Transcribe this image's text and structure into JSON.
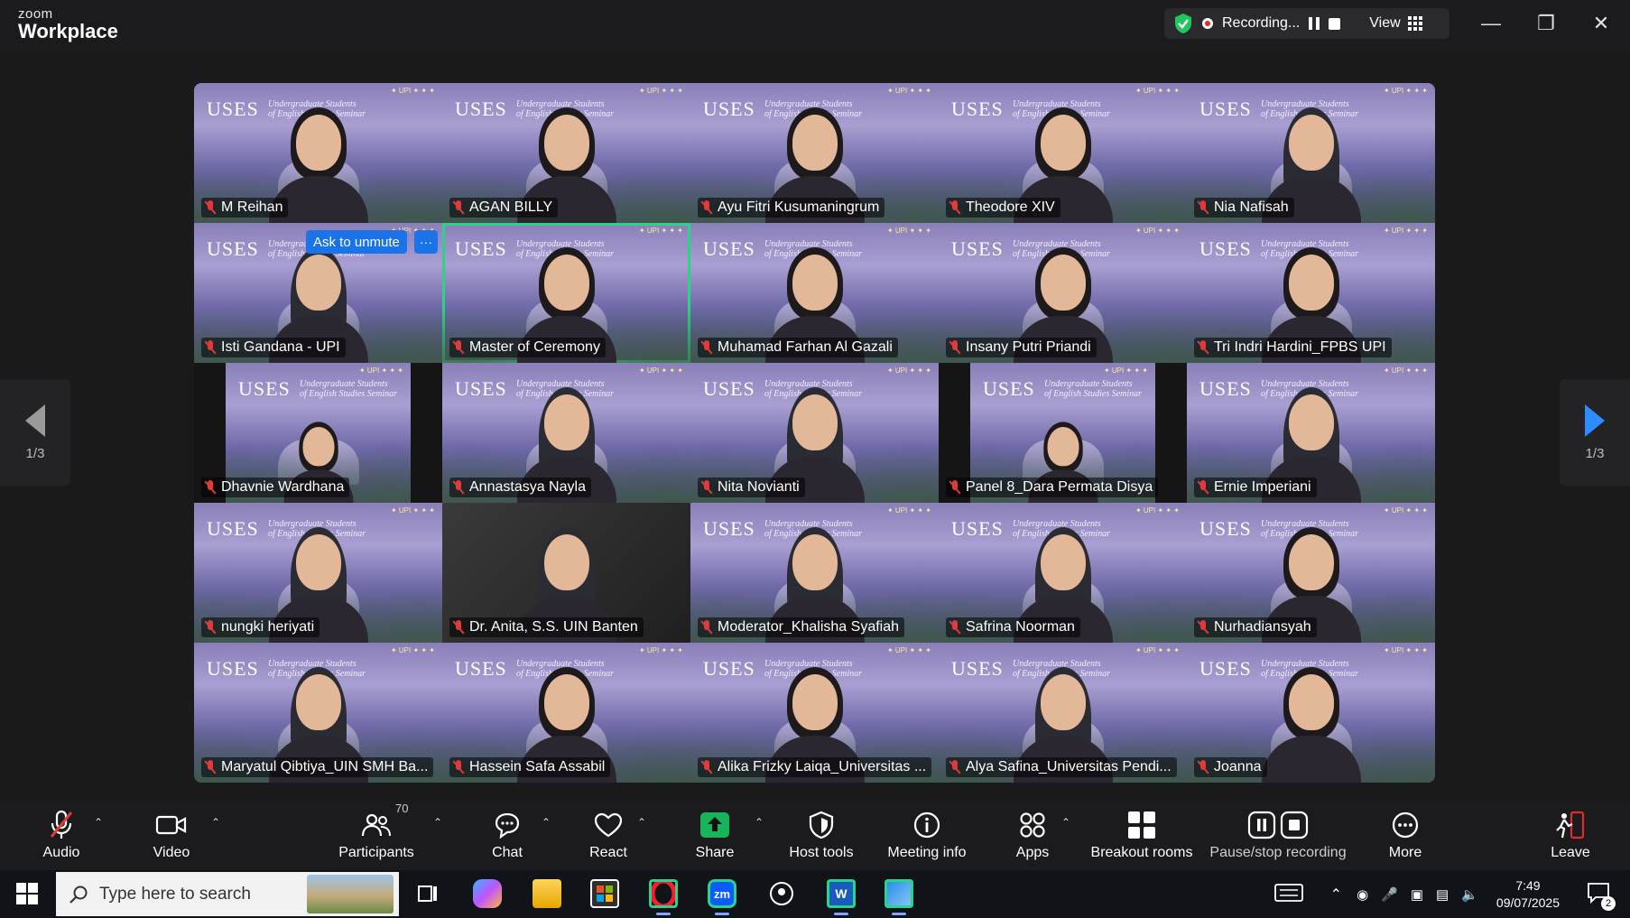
{
  "app": {
    "logo_small": "zoom",
    "logo_big": "Workplace"
  },
  "topbar": {
    "recording_label": "Recording...",
    "view_label": "View"
  },
  "tile_banner": {
    "uses": "USES",
    "subtitle_1": "Undergraduate Students",
    "subtitle_2": "of English Studies Seminar",
    "logos": "✦ UPI ✦ ✦ ✦"
  },
  "unmute": {
    "ask_label": "Ask to unmute",
    "more_label": "···"
  },
  "participants": [
    {
      "name": "M Reihan"
    },
    {
      "name": "AGAN BILLY"
    },
    {
      "name": "Ayu Fitri Kusumaningrum"
    },
    {
      "name": "Theodore XIV"
    },
    {
      "name": "Nia Nafisah"
    },
    {
      "name": "Isti Gandana - UPI"
    },
    {
      "name": "Master of Ceremony"
    },
    {
      "name": "Muhamad Farhan Al Gazali"
    },
    {
      "name": "Insany Putri Priandi"
    },
    {
      "name": "Tri Indri Hardini_FPBS UPI"
    },
    {
      "name": "Dhavnie Wardhana"
    },
    {
      "name": "Annastasya Nayla"
    },
    {
      "name": "Nita Novianti"
    },
    {
      "name": "Panel 8_Dara Permata Disya"
    },
    {
      "name": "Ernie Imperiani"
    },
    {
      "name": "nungki heriyati"
    },
    {
      "name": "Dr. Anita, S.S. UIN Banten"
    },
    {
      "name": "Moderator_Khalisha Syafiah"
    },
    {
      "name": "Safrina Noorman"
    },
    {
      "name": "Nurhadiansyah"
    },
    {
      "name": "Maryatul Qibtiya_UIN SMH Ba..."
    },
    {
      "name": "Hassein Safa Assabil"
    },
    {
      "name": "Alika Frizky Laiqa_Universitas ..."
    },
    {
      "name": "Alya Safina_Universitas Pendi..."
    },
    {
      "name": "Joanna"
    }
  ],
  "pager": {
    "left_label": "1/3",
    "right_label": "1/3"
  },
  "toolbar": {
    "audio": "Audio",
    "video": "Video",
    "participants": "Participants",
    "participants_count": "70",
    "chat": "Chat",
    "react": "React",
    "share": "Share",
    "host_tools": "Host tools",
    "meeting_info": "Meeting info",
    "apps": "Apps",
    "breakout_rooms": "Breakout rooms",
    "pause_stop_recording": "Pause/stop recording",
    "more": "More",
    "leave": "Leave"
  },
  "taskbar": {
    "search_placeholder": "Type here to search",
    "time": "7:49",
    "date": "09/07/2025",
    "notification_count": "2",
    "apps": [
      "task-view",
      "copilot",
      "file-explorer",
      "microsoft-store",
      "opera",
      "zoom",
      "maps",
      "word",
      "photos"
    ]
  },
  "colors": {
    "accent": "#2d8cff",
    "share_green": "#18b45b",
    "active_speaker": "#2fd18a",
    "leave_red": "#e02b2b",
    "mute_red": "#e03a3a"
  }
}
